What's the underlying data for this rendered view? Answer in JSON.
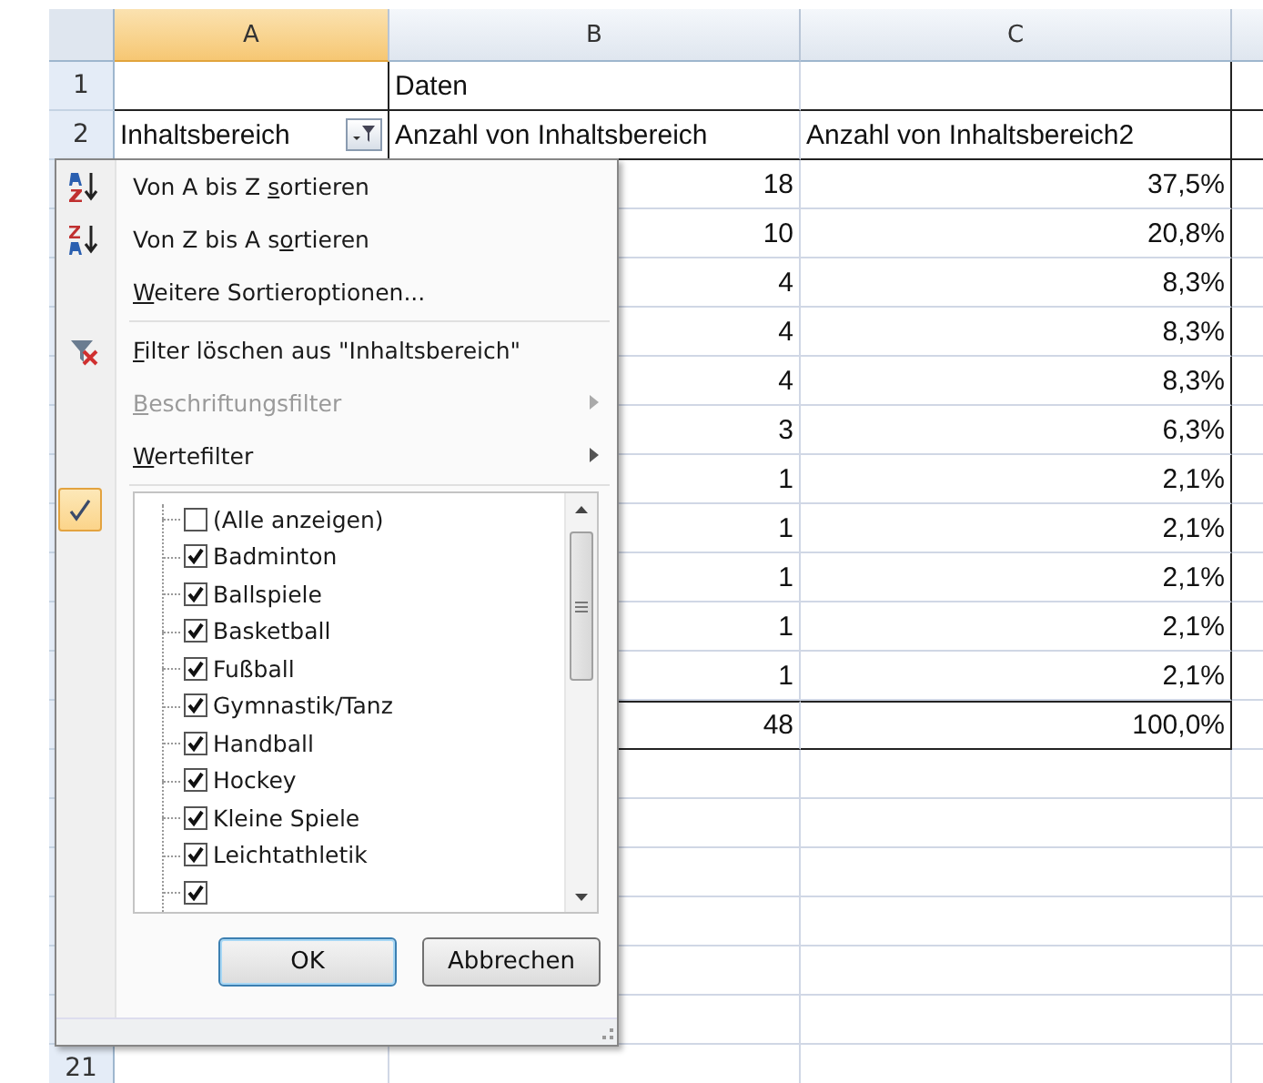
{
  "columns": [
    {
      "label": "A",
      "selected": true
    },
    {
      "label": "B",
      "selected": false
    },
    {
      "label": "C",
      "selected": false
    }
  ],
  "rows": [
    {
      "number": "1",
      "kind": "caption",
      "b": "Daten"
    },
    {
      "number": "2",
      "kind": "header",
      "a": "Inhaltsbereich",
      "filter": true,
      "b": "Anzahl von Inhaltsbereich",
      "c": "Anzahl von Inhaltsbereich2"
    },
    {
      "kind": "data",
      "b": "18",
      "c": "37,5%"
    },
    {
      "kind": "data",
      "b": "10",
      "c": "20,8%"
    },
    {
      "kind": "data",
      "b": "4",
      "c": "8,3%"
    },
    {
      "kind": "data",
      "b": "4",
      "c": "8,3%"
    },
    {
      "kind": "data",
      "b": "4",
      "c": "8,3%"
    },
    {
      "kind": "data",
      "b": "3",
      "c": "6,3%"
    },
    {
      "kind": "data",
      "b": "1",
      "c": "2,1%"
    },
    {
      "kind": "data",
      "b": "1",
      "c": "2,1%"
    },
    {
      "kind": "data",
      "b": "1",
      "c": "2,1%"
    },
    {
      "kind": "data",
      "b": "1",
      "c": "2,1%"
    },
    {
      "kind": "data",
      "b": "1",
      "c": "2,1%"
    },
    {
      "kind": "total",
      "b": "48",
      "c": "100,0%"
    }
  ],
  "last_row": {
    "number": "21"
  },
  "menu": {
    "items": [
      {
        "kind": "sort_ascending",
        "before": "Von A bis Z ",
        "key": "s",
        "after": "ortieren",
        "disabled": false,
        "submenu": false
      },
      {
        "kind": "sort_descending",
        "before": "Von Z bis A s",
        "key": "o",
        "after": "rtieren",
        "disabled": false,
        "submenu": false
      },
      {
        "kind": "item",
        "key": "W",
        "after": "eitere Sortieroptionen...",
        "disabled": false,
        "submenu": false
      },
      {
        "kind": "separator"
      },
      {
        "kind": "clear_filter",
        "key": "F",
        "after": "ilter löschen aus \"Inhaltsbereich\"",
        "disabled": false,
        "submenu": false
      },
      {
        "kind": "item",
        "key": "B",
        "after": "eschriftungsfilter",
        "disabled": true,
        "submenu": true
      },
      {
        "kind": "item",
        "key": "W",
        "after": "ertefilter",
        "disabled": false,
        "submenu": true
      },
      {
        "kind": "separator"
      }
    ],
    "list_checked_marker": true,
    "values": [
      {
        "label": "(Alle anzeigen)",
        "checked": false
      },
      {
        "label": "Badminton",
        "checked": true
      },
      {
        "label": "Ballspiele",
        "checked": true
      },
      {
        "label": "Basketball",
        "checked": true
      },
      {
        "label": "Fußball",
        "checked": true
      },
      {
        "label": "Gymnastik/Tanz",
        "checked": true
      },
      {
        "label": "Handball",
        "checked": true
      },
      {
        "label": "Hockey",
        "checked": true
      },
      {
        "label": "Kleine Spiele",
        "checked": true
      },
      {
        "label": "Leichtathletik",
        "checked": true
      },
      {
        "checked": true
      }
    ],
    "buttons": [
      {
        "label": "OK",
        "default": true
      },
      {
        "label": "Abbrechen",
        "default": false
      }
    ]
  }
}
